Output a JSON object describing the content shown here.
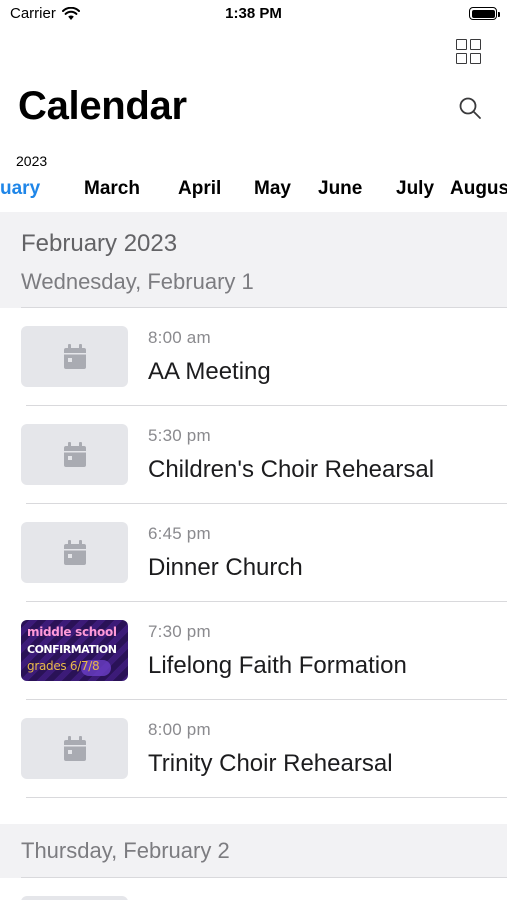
{
  "status_bar": {
    "carrier": "Carrier",
    "time": "1:38 PM"
  },
  "header": {
    "title": "Calendar",
    "grid_icon": "grid-view-icon",
    "search_icon": "search-icon"
  },
  "month_strip": {
    "year": "2023",
    "months": [
      {
        "label": "uary",
        "active": true
      },
      {
        "label": "March",
        "active": false
      },
      {
        "label": "April",
        "active": false
      },
      {
        "label": "May",
        "active": false
      },
      {
        "label": "June",
        "active": false
      },
      {
        "label": "July",
        "active": false
      },
      {
        "label": "Augus",
        "active": false
      }
    ],
    "accent_color": "#1f86e8"
  },
  "list": {
    "section_month": "February 2023",
    "days": [
      {
        "label": "Wednesday, February 1",
        "events": [
          {
            "time": "8:00 am",
            "title": "AA Meeting",
            "thumb": "calendar-icon"
          },
          {
            "time": "5:30 pm",
            "title": "Children's Choir Rehearsal",
            "thumb": "calendar-icon"
          },
          {
            "time": "6:45 pm",
            "title": "Dinner Church",
            "thumb": "calendar-icon"
          },
          {
            "time": "7:30 pm",
            "title": "Lifelong Faith Formation",
            "thumb": "promo-image",
            "promo_lines": [
              "middle school",
              "CONFIRMATION",
              "grades 6/7/8"
            ]
          },
          {
            "time": "8:00 pm",
            "title": "Trinity Choir Rehearsal",
            "thumb": "calendar-icon"
          }
        ]
      },
      {
        "label": "Thursday, February 2",
        "events": []
      }
    ]
  }
}
